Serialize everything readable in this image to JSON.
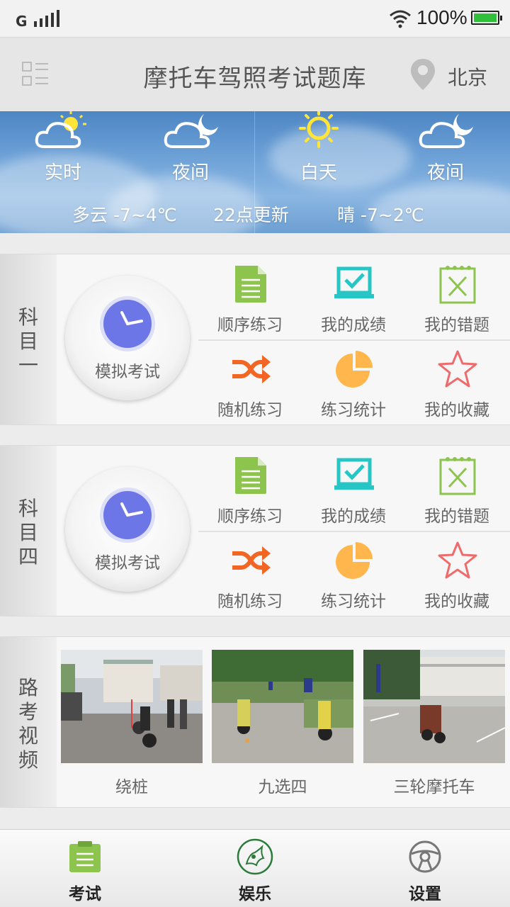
{
  "status_bar": {
    "network": "G",
    "battery": "100%"
  },
  "header": {
    "title": "摩托车驾照考试题库",
    "city": "北京"
  },
  "weather": {
    "labels": [
      "实时",
      "夜间",
      "白天",
      "夜间"
    ],
    "today": "多云 -7~4℃",
    "update": "22点更新",
    "tomorrow": "晴 -7~2℃"
  },
  "subject1": {
    "label_chars": [
      "科",
      "目",
      "一"
    ],
    "exam_label": "模拟考试",
    "items": [
      "顺序练习",
      "我的成绩",
      "我的错题",
      "随机练习",
      "练习统计",
      "我的收藏"
    ]
  },
  "subject4": {
    "label_chars": [
      "科",
      "目",
      "四"
    ],
    "exam_label": "模拟考试",
    "items": [
      "顺序练习",
      "我的成绩",
      "我的错题",
      "随机练习",
      "练习统计",
      "我的收藏"
    ]
  },
  "road_videos": {
    "label_chars": [
      "路",
      "考",
      "视",
      "频"
    ],
    "videos": [
      "绕桩",
      "九选四",
      "三轮摩托车"
    ]
  },
  "bottom_nav": [
    "考试",
    "娱乐",
    "设置"
  ],
  "colors": {
    "green": "#8dc44e",
    "cyan": "#26c6c6",
    "orange": "#f26522",
    "yellow": "#ffb74d",
    "red_star": "#ef6b6b",
    "clock": "#6d76e6"
  },
  "icons": {
    "cells": [
      "document-icon",
      "laptop-check-icon",
      "wrong-questions-icon",
      "shuffle-icon",
      "pie-chart-icon",
      "star-icon"
    ],
    "nav": [
      "exam-icon",
      "entertainment-icon",
      "steering-wheel-icon"
    ]
  }
}
